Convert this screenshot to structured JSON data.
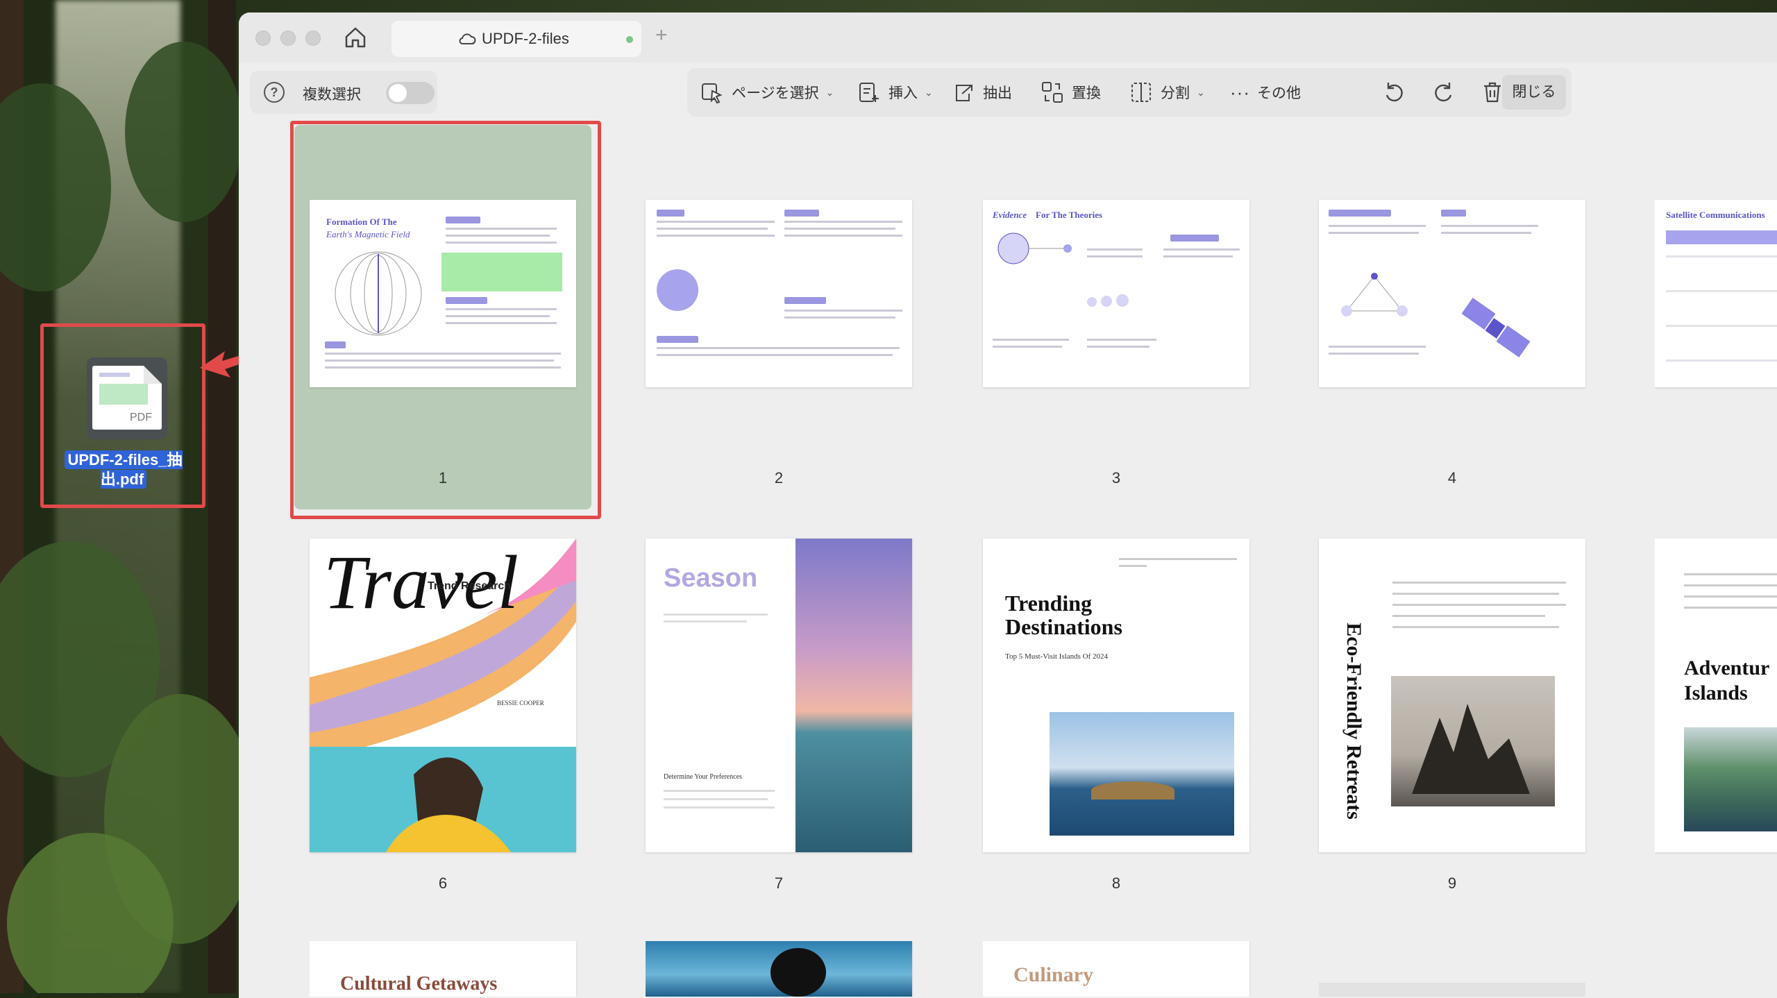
{
  "desktop": {
    "file_label": "UPDF-2-files_抽出.pdf",
    "file_badge": "PDF"
  },
  "tab": {
    "title": "UPDF-2-files"
  },
  "leftbar": {
    "help_glyph": "?",
    "multi_select_label": "複数選択"
  },
  "toolbar": {
    "select_pages": "ページを選択",
    "insert": "挿入",
    "extract": "抽出",
    "replace": "置換",
    "split": "分割",
    "more": "その他",
    "close": "閉じる"
  },
  "pages": [
    {
      "num": "1",
      "title_a": "Formation Of The",
      "title_b": "Earth's Magnetic Field"
    },
    {
      "num": "2"
    },
    {
      "num": "3",
      "title_a": "Evidence",
      "title_b": "For The Theories"
    },
    {
      "num": "4"
    },
    {
      "num": "",
      "title_a": "Satellite Communications"
    },
    {
      "num": "6",
      "title_a": "Travel",
      "subtitle": "Trend Research",
      "author": "BESSIE COOPER"
    },
    {
      "num": "7",
      "title_a": "Season",
      "subtitle": "Determine Your Preferences"
    },
    {
      "num": "8",
      "title_a": "Trending",
      "title_b": "Destinations",
      "subtitle": "Top 5 Must-Visit Islands Of 2024"
    },
    {
      "num": "9",
      "title_a": "Eco-Friendly Retreats"
    },
    {
      "num": "",
      "title_a": "Adventur",
      "title_b": "Islands"
    },
    {
      "title_a": "Cultural Getaways"
    },
    {
      "title_a": ""
    },
    {
      "title_a": "Culinary"
    }
  ],
  "colors": {
    "selection": "#e24a4a",
    "accent": "#5b55c9",
    "file_highlight": "#2f63d8"
  }
}
